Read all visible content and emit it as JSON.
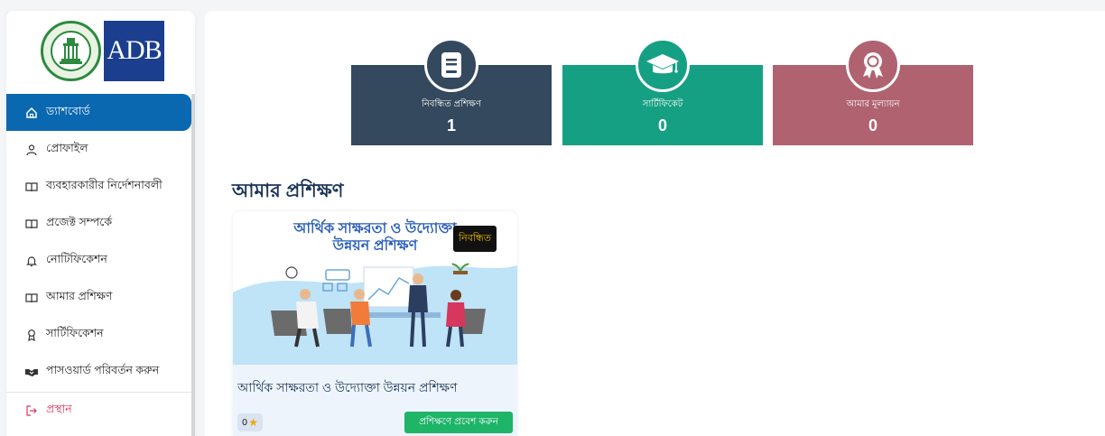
{
  "sidebar": {
    "logos": {
      "bank": "Bangladesh Bank logo",
      "adb_text": "ADB"
    },
    "items": [
      {
        "label": "ড্যাশবোর্ড",
        "icon": "home-icon",
        "active": true
      },
      {
        "label": "প্রোফাইল",
        "icon": "user-icon"
      },
      {
        "label": "ব্যবহারকারীর নির্দেশনাবলী",
        "icon": "book-icon"
      },
      {
        "label": "প্রজেক্ট সম্পর্কে",
        "icon": "book-icon"
      },
      {
        "label": "নোটিফিকেশন",
        "icon": "bell-icon"
      },
      {
        "label": "আমার প্রশিক্ষণ",
        "icon": "book-icon"
      },
      {
        "label": "সার্টিফিকেশন",
        "icon": "award-icon"
      },
      {
        "label": "পাসওয়ার্ড পরিবর্তন করুন",
        "icon": "handshake-icon"
      }
    ],
    "logout": {
      "label": "প্রস্থান",
      "icon": "logout-icon"
    }
  },
  "stats": [
    {
      "label": "নিবন্ধিত প্রশিক্ষণ",
      "value": "1",
      "icon": "document-icon",
      "color": "#34495e"
    },
    {
      "label": "সার্টিফিকেট",
      "value": "0",
      "icon": "graduation-cap-icon",
      "color": "#16a083"
    },
    {
      "label": "আমার মূল্যায়ন",
      "value": "0",
      "icon": "rosette-icon",
      "color": "#b06270"
    }
  ],
  "section": {
    "title": "আমার প্রশিক্ষণ"
  },
  "course": {
    "banner_line1": "আর্থিক সাক্ষরতা ও উদ্যোক্তা",
    "banner_line2": "উন্নয়ন প্রশিক্ষণ",
    "badge": "নিবন্ধিত",
    "title": "আর্থিক সাক্ষরতা ও উদ্যোক্তা উন্নয়ন প্রশিক্ষণ",
    "rating": "0",
    "enter_label": "প্রশিক্ষণে প্রবেশ করুন"
  }
}
